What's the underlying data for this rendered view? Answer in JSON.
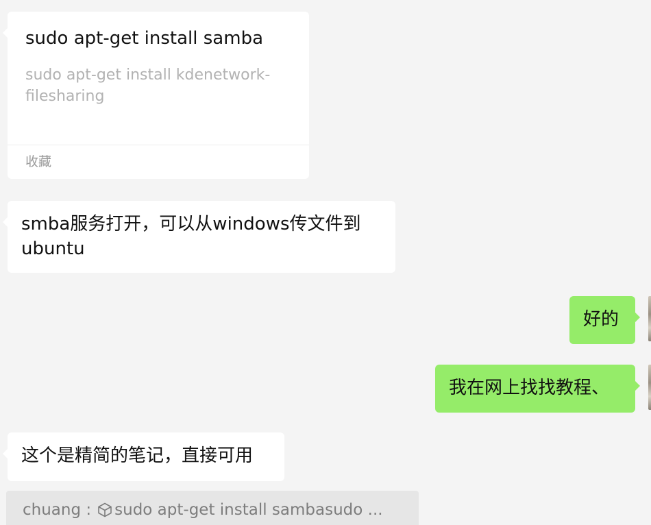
{
  "card": {
    "title": "sudo apt-get install samba",
    "description": "sudo apt-get install kdenetwork-filesharing",
    "source": "收藏"
  },
  "messages": [
    {
      "side": "left",
      "text": "smba服务打开，可以从windows传文件到ubuntu"
    },
    {
      "side": "right",
      "text": "好的"
    },
    {
      "side": "right",
      "text": "我在网上找找教程、"
    },
    {
      "side": "left",
      "text": "这个是精简的笔记，直接可用"
    }
  ],
  "quote": {
    "sender": "chuang :",
    "icon": "cube-icon",
    "text": "sudo apt-get install sambasudo ..."
  },
  "colors": {
    "background": "#f4f4f4",
    "incoming_bubble": "#ffffff",
    "outgoing_bubble": "#95ec69",
    "quote_background": "#e6e6e6"
  }
}
